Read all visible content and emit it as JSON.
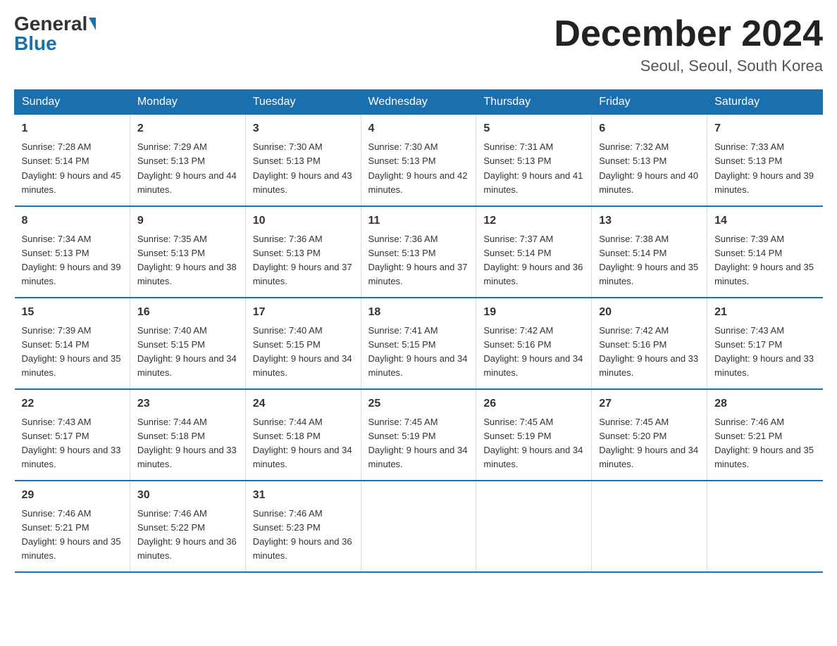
{
  "header": {
    "logo_general": "General",
    "logo_blue": "Blue",
    "month_title": "December 2024",
    "location": "Seoul, Seoul, South Korea"
  },
  "weekdays": [
    "Sunday",
    "Monday",
    "Tuesday",
    "Wednesday",
    "Thursday",
    "Friday",
    "Saturday"
  ],
  "weeks": [
    [
      {
        "day": "1",
        "sunrise": "7:28 AM",
        "sunset": "5:14 PM",
        "daylight": "9 hours and 45 minutes."
      },
      {
        "day": "2",
        "sunrise": "7:29 AM",
        "sunset": "5:13 PM",
        "daylight": "9 hours and 44 minutes."
      },
      {
        "day": "3",
        "sunrise": "7:30 AM",
        "sunset": "5:13 PM",
        "daylight": "9 hours and 43 minutes."
      },
      {
        "day": "4",
        "sunrise": "7:30 AM",
        "sunset": "5:13 PM",
        "daylight": "9 hours and 42 minutes."
      },
      {
        "day": "5",
        "sunrise": "7:31 AM",
        "sunset": "5:13 PM",
        "daylight": "9 hours and 41 minutes."
      },
      {
        "day": "6",
        "sunrise": "7:32 AM",
        "sunset": "5:13 PM",
        "daylight": "9 hours and 40 minutes."
      },
      {
        "day": "7",
        "sunrise": "7:33 AM",
        "sunset": "5:13 PM",
        "daylight": "9 hours and 39 minutes."
      }
    ],
    [
      {
        "day": "8",
        "sunrise": "7:34 AM",
        "sunset": "5:13 PM",
        "daylight": "9 hours and 39 minutes."
      },
      {
        "day": "9",
        "sunrise": "7:35 AM",
        "sunset": "5:13 PM",
        "daylight": "9 hours and 38 minutes."
      },
      {
        "day": "10",
        "sunrise": "7:36 AM",
        "sunset": "5:13 PM",
        "daylight": "9 hours and 37 minutes."
      },
      {
        "day": "11",
        "sunrise": "7:36 AM",
        "sunset": "5:13 PM",
        "daylight": "9 hours and 37 minutes."
      },
      {
        "day": "12",
        "sunrise": "7:37 AM",
        "sunset": "5:14 PM",
        "daylight": "9 hours and 36 minutes."
      },
      {
        "day": "13",
        "sunrise": "7:38 AM",
        "sunset": "5:14 PM",
        "daylight": "9 hours and 35 minutes."
      },
      {
        "day": "14",
        "sunrise": "7:39 AM",
        "sunset": "5:14 PM",
        "daylight": "9 hours and 35 minutes."
      }
    ],
    [
      {
        "day": "15",
        "sunrise": "7:39 AM",
        "sunset": "5:14 PM",
        "daylight": "9 hours and 35 minutes."
      },
      {
        "day": "16",
        "sunrise": "7:40 AM",
        "sunset": "5:15 PM",
        "daylight": "9 hours and 34 minutes."
      },
      {
        "day": "17",
        "sunrise": "7:40 AM",
        "sunset": "5:15 PM",
        "daylight": "9 hours and 34 minutes."
      },
      {
        "day": "18",
        "sunrise": "7:41 AM",
        "sunset": "5:15 PM",
        "daylight": "9 hours and 34 minutes."
      },
      {
        "day": "19",
        "sunrise": "7:42 AM",
        "sunset": "5:16 PM",
        "daylight": "9 hours and 34 minutes."
      },
      {
        "day": "20",
        "sunrise": "7:42 AM",
        "sunset": "5:16 PM",
        "daylight": "9 hours and 33 minutes."
      },
      {
        "day": "21",
        "sunrise": "7:43 AM",
        "sunset": "5:17 PM",
        "daylight": "9 hours and 33 minutes."
      }
    ],
    [
      {
        "day": "22",
        "sunrise": "7:43 AM",
        "sunset": "5:17 PM",
        "daylight": "9 hours and 33 minutes."
      },
      {
        "day": "23",
        "sunrise": "7:44 AM",
        "sunset": "5:18 PM",
        "daylight": "9 hours and 33 minutes."
      },
      {
        "day": "24",
        "sunrise": "7:44 AM",
        "sunset": "5:18 PM",
        "daylight": "9 hours and 34 minutes."
      },
      {
        "day": "25",
        "sunrise": "7:45 AM",
        "sunset": "5:19 PM",
        "daylight": "9 hours and 34 minutes."
      },
      {
        "day": "26",
        "sunrise": "7:45 AM",
        "sunset": "5:19 PM",
        "daylight": "9 hours and 34 minutes."
      },
      {
        "day": "27",
        "sunrise": "7:45 AM",
        "sunset": "5:20 PM",
        "daylight": "9 hours and 34 minutes."
      },
      {
        "day": "28",
        "sunrise": "7:46 AM",
        "sunset": "5:21 PM",
        "daylight": "9 hours and 35 minutes."
      }
    ],
    [
      {
        "day": "29",
        "sunrise": "7:46 AM",
        "sunset": "5:21 PM",
        "daylight": "9 hours and 35 minutes."
      },
      {
        "day": "30",
        "sunrise": "7:46 AM",
        "sunset": "5:22 PM",
        "daylight": "9 hours and 36 minutes."
      },
      {
        "day": "31",
        "sunrise": "7:46 AM",
        "sunset": "5:23 PM",
        "daylight": "9 hours and 36 minutes."
      },
      null,
      null,
      null,
      null
    ]
  ]
}
